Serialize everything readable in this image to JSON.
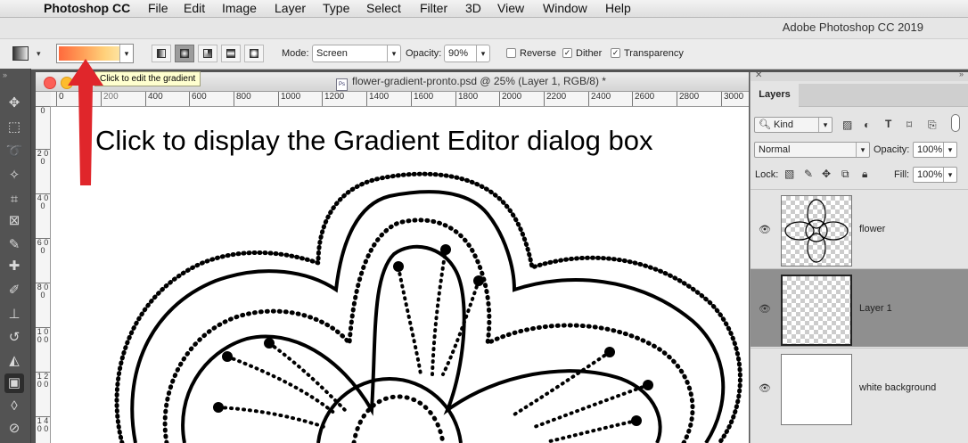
{
  "menubar": {
    "app_name": "Photoshop CC",
    "items": [
      "File",
      "Edit",
      "Image",
      "Layer",
      "Type",
      "Select",
      "Filter",
      "3D",
      "View",
      "Window",
      "Help"
    ]
  },
  "app_title": "Adobe Photoshop CC 2019",
  "options_bar": {
    "mode_label": "Mode:",
    "mode_value": "Screen",
    "opacity_label": "Opacity:",
    "opacity_value": "90%",
    "reverse_label": "Reverse",
    "reverse_checked": false,
    "dither_label": "Dither",
    "dither_checked": true,
    "transparency_label": "Transparency",
    "transparency_checked": true,
    "gradient_colors": [
      "#ff6a3d",
      "#ff9f58",
      "#ffd07a",
      "#fde3a0"
    ]
  },
  "tooltip": "Click to edit the gradient",
  "document": {
    "tab_title": "flower-gradient-pronto.psd @ 25% (Layer 1, RGB/8) *",
    "icon_text": "Ps",
    "annotation": "Click to display the Gradient Editor dialog box",
    "ruler_h": [
      "0",
      "200",
      "400",
      "600",
      "800",
      "1000",
      "1200",
      "1400",
      "1600",
      "1800",
      "2000",
      "2200",
      "2400",
      "2600",
      "2800",
      "3000"
    ],
    "ruler_v": [
      "0",
      "2 0 0",
      "4 0 0",
      "6 0 0",
      "8 0 0",
      "1 0 0 0",
      "1 2 0 0",
      "1 4 0 0"
    ]
  },
  "layers_panel": {
    "tab": "Layers",
    "filter_kind": "Kind",
    "blend_mode": "Normal",
    "opacity_label": "Opacity:",
    "opacity_value": "100%",
    "lock_label": "Lock:",
    "fill_label": "Fill:",
    "fill_value": "100%",
    "layers": [
      {
        "name": "flower",
        "selected": false
      },
      {
        "name": "Layer 1",
        "selected": true
      },
      {
        "name": "white background",
        "selected": false
      }
    ]
  },
  "icons": {
    "tools": [
      "move-icon",
      "marquee-icon",
      "lasso-icon",
      "magic-wand-icon",
      "crop-icon",
      "frame-icon",
      "eyedropper-icon",
      "healing-brush-icon",
      "brush-icon",
      "clone-stamp-icon",
      "history-brush-icon",
      "eraser-icon",
      "gradient-icon",
      "blur-icon",
      "dodge-icon"
    ],
    "accent_red": "#e0262b"
  }
}
